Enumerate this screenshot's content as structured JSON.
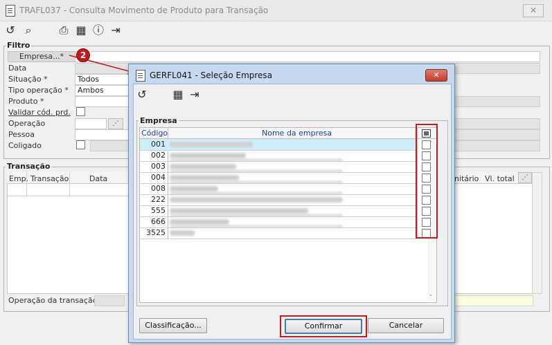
{
  "main_window": {
    "title": "TRAFL037 - Consulta Movimento de Produto para Transação",
    "close_label": "✕"
  },
  "filtro": {
    "legend": "Filtro",
    "empresa_button": "Empresa...*",
    "labels": [
      "Data",
      "Situação *",
      "Tipo operação *",
      "Produto *",
      "Validar cód. prd.",
      "Operação",
      "Pessoa",
      "Coligado"
    ],
    "situacao_value": "Todos",
    "tipo_operacao_value": "Ambos"
  },
  "transacao": {
    "legend": "Transação",
    "columns": [
      "Emp.",
      "Transação",
      "Data"
    ],
    "right_columns": [
      "nitário",
      "Vl. total"
    ],
    "operacao_label": "Operação da transação"
  },
  "annotation": {
    "step": "2"
  },
  "dialog": {
    "title": "GERFL041 - Seleção Empresa",
    "close_label": "✕",
    "group_label": "Empresa",
    "col_codigo": "Código",
    "col_nome": "Nome da empresa",
    "rows": [
      {
        "code": "001"
      },
      {
        "code": "002"
      },
      {
        "code": "003"
      },
      {
        "code": "004"
      },
      {
        "code": "008"
      },
      {
        "code": "222"
      },
      {
        "code": "555"
      },
      {
        "code": "666"
      },
      {
        "code": "3525"
      }
    ],
    "btn_classificacao": "Classificação...",
    "btn_confirmar": "Confirmar",
    "btn_cancelar": "Cancelar"
  },
  "colors": {
    "highlight_red": "#c41a1a",
    "header_blue": "#1a3fa0",
    "selected_row": "#cfeefa"
  }
}
